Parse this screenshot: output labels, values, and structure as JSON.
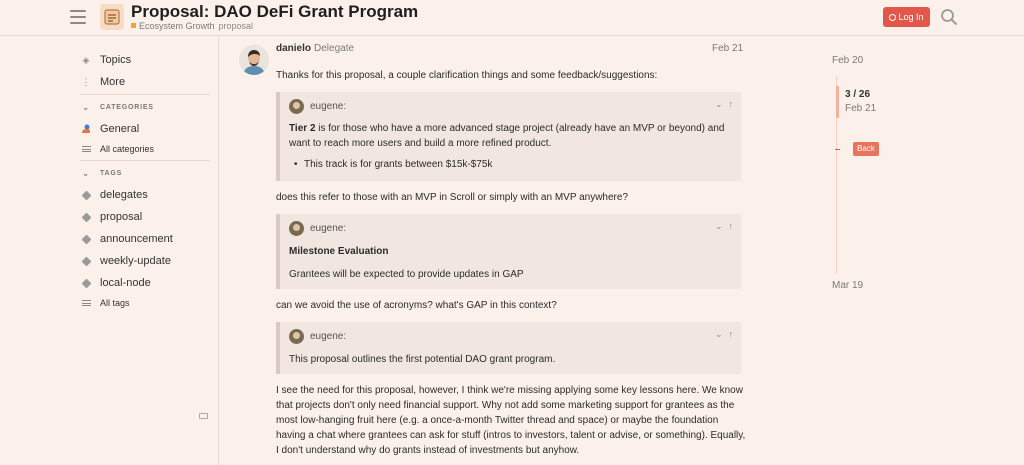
{
  "header": {
    "title": "Proposal: DAO DeFi Grant Program",
    "category": "Ecosystem Growth",
    "tag": "proposal",
    "login_label": "Log In",
    "accent_color": "#e1574a"
  },
  "sidebar": {
    "topics": "Topics",
    "more": "More",
    "categories_heading": "CATEGORIES",
    "general": "General",
    "all_categories": "All categories",
    "tags_heading": "TAGS",
    "tags": [
      "delegates",
      "proposal",
      "announcement",
      "weekly-update",
      "local-node"
    ],
    "all_tags": "All tags"
  },
  "post": {
    "author": "danielo",
    "role": "Delegate",
    "date": "Feb 21",
    "intro": "Thanks for this proposal, a couple clarification things and some feedback/suggestions:",
    "quote1": {
      "user": "eugene:",
      "bold": "Tier 2",
      "text": " is for those who have a more advanced stage project (already have an MVP or beyond) and want to reach more users and build a more refined product.",
      "bullet": "This track is for grants between $15k-$75k"
    },
    "reply1": "does this refer to those with an MVP in Scroll or simply with an MVP anywhere?",
    "quote2": {
      "user": "eugene:",
      "heading": "Milestone Evaluation",
      "text": "Grantees will be expected to provide updates in GAP"
    },
    "reply2": "can we avoid the use of acronyms? what's GAP in this context?",
    "quote3": {
      "user": "eugene:",
      "text": "This proposal outlines the first potential DAO grant program."
    },
    "reply3": "I see the need for this proposal, however, I think we're missing applying some key lessons here. We know that projects don't only need financial support. Why not add some marketing support for grantees as the most low-hanging fruit here (e.g. a once-a-month Twitter thread and space) or maybe the foundation having a chat where grantees can ask for stuff (intros to investors, talent or advise, or something). Equally, I don't understand why do grants instead of investments but anyhow."
  },
  "timeline": {
    "start": "Feb 20",
    "position": "3 / 26",
    "position_date": "Feb 21",
    "back_label": "Back",
    "end": "Mar 19"
  }
}
